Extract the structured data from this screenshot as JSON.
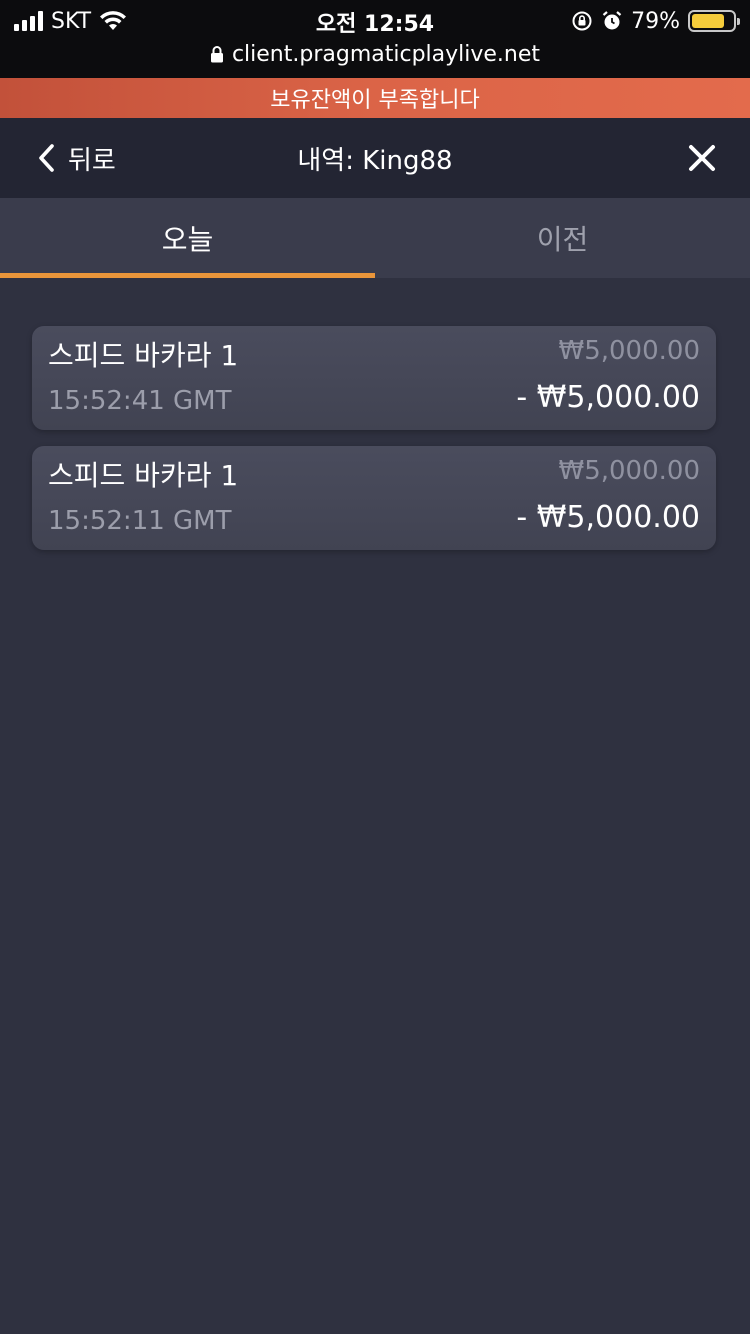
{
  "status_bar": {
    "carrier": "SKT",
    "time": "오전 12:54",
    "battery_percent": "79%",
    "battery_level": 0.79,
    "url": "client.pragmaticplaylive.net",
    "icons": [
      "signal-icon",
      "wifi-icon",
      "rotation-lock-icon",
      "alarm-icon",
      "battery-icon",
      "lock-icon"
    ]
  },
  "banner": {
    "text": "보유잔액이 부족합니다",
    "color": "#d95f44"
  },
  "header": {
    "back_label": "뒤로",
    "title": "내역: King88"
  },
  "tabs": [
    {
      "label": "오늘",
      "active": true
    },
    {
      "label": "이전",
      "active": false
    }
  ],
  "accent_color": "#e9953a",
  "history": [
    {
      "game": "스피드 바카라 1",
      "bet": "₩5,000.00",
      "time": "15:52:41 GMT",
      "result": "- ₩5,000.00"
    },
    {
      "game": "스피드 바카라 1",
      "bet": "₩5,000.00",
      "time": "15:52:11 GMT",
      "result": "- ₩5,000.00"
    }
  ]
}
